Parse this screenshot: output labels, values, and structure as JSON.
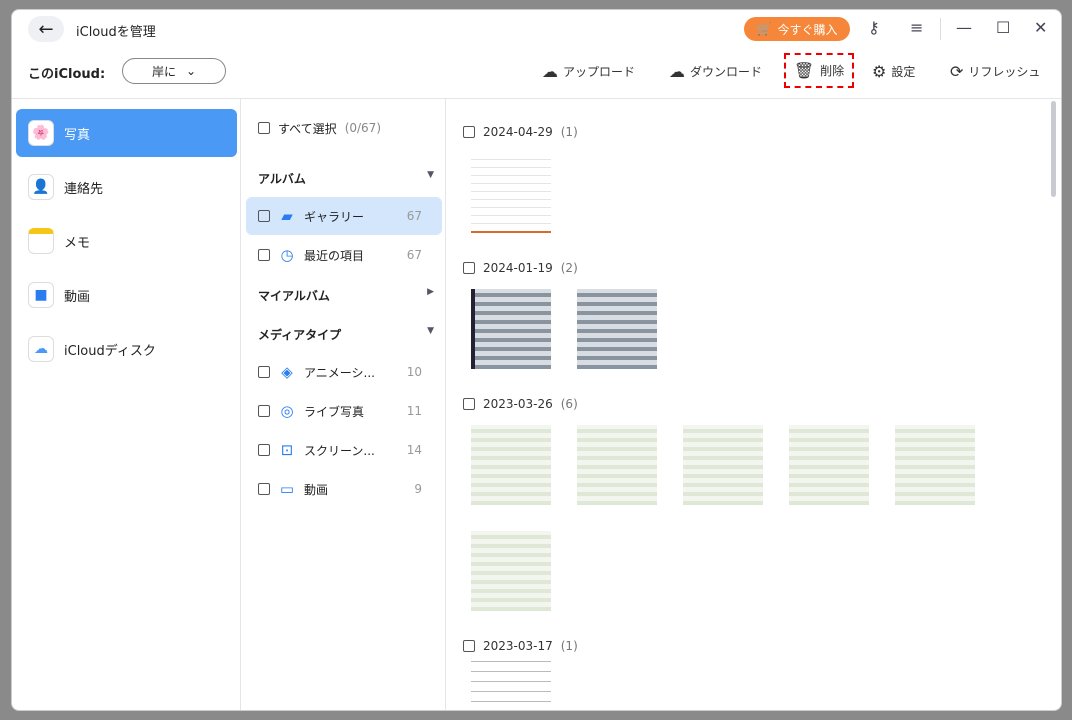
{
  "header": {
    "title": "iCloudを管理",
    "buy_label": "今すぐ購入",
    "icloud_label": "このiCloud:",
    "account": "岸に"
  },
  "toolbar": {
    "upload": "アップロード",
    "download": "ダウンロード",
    "delete": "削除",
    "settings": "設定",
    "refresh": "リフレッシュ"
  },
  "sidebar": {
    "items": [
      {
        "label": "写真"
      },
      {
        "label": "連絡先"
      },
      {
        "label": "メモ"
      },
      {
        "label": "動画"
      },
      {
        "label": "iCloudディスク"
      }
    ]
  },
  "albums": {
    "select_all": "すべて選択",
    "select_count": "(0/67)",
    "album_header": "アルバム",
    "my_album_header": "マイアルバム",
    "media_header": "メディアタイプ",
    "albums": [
      {
        "label": "ギャラリー",
        "count": "67"
      },
      {
        "label": "最近の項目",
        "count": "67"
      }
    ],
    "media": [
      {
        "label": "アニメーシ...",
        "count": "10"
      },
      {
        "label": "ライブ写真",
        "count": "11"
      },
      {
        "label": "スクリーン...",
        "count": "14"
      },
      {
        "label": "動画",
        "count": "9"
      }
    ]
  },
  "groups": [
    {
      "date": "2024-04-29",
      "count": "(1)"
    },
    {
      "date": "2024-01-19",
      "count": "(2)"
    },
    {
      "date": "2023-03-26",
      "count": "(6)"
    },
    {
      "date": "2023-03-17",
      "count": "(1)"
    }
  ],
  "colors": {
    "accent": "#4a9af5",
    "buy": "#f5863a",
    "highlight": "#e00000"
  }
}
